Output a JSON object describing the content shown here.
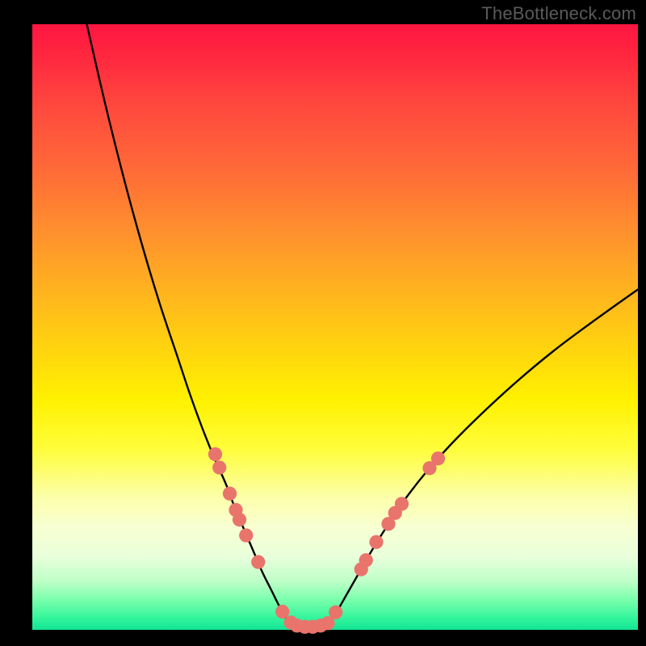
{
  "watermark": "TheBottleneck.com",
  "chart_data": {
    "type": "line",
    "title": "",
    "xlabel": "",
    "ylabel": "",
    "xlim": [
      0,
      100
    ],
    "ylim": [
      0,
      100
    ],
    "grid": false,
    "legend": false,
    "background_gradient": {
      "direction": "vertical",
      "stops": [
        {
          "pos": 0.0,
          "color": "#ff1540"
        },
        {
          "pos": 0.5,
          "color": "#ffd000"
        },
        {
          "pos": 0.8,
          "color": "#fbffb0"
        },
        {
          "pos": 1.0,
          "color": "#12e495"
        }
      ]
    },
    "series": [
      {
        "name": "left-curve",
        "stroke": "#000000",
        "x": [
          9,
          12,
          15,
          18,
          21,
          24,
          26,
          28,
          30,
          32,
          33.5,
          35,
          36.5,
          38,
          39.5,
          41,
          43
        ],
        "y": [
          100,
          87,
          75,
          64,
          54,
          45,
          39,
          33.5,
          28.5,
          24,
          20,
          16.5,
          13,
          9.5,
          6.5,
          3.5,
          0
        ]
      },
      {
        "name": "right-curve",
        "stroke": "#000000",
        "x": [
          48.5,
          50,
          52,
          54,
          56,
          58.5,
          61.5,
          65,
          69,
          74,
          80,
          86,
          92,
          98,
          100
        ],
        "y": [
          0,
          2.5,
          6,
          9.5,
          13,
          17,
          21.5,
          26,
          30.5,
          35.5,
          41,
          46,
          50.5,
          54.8,
          56.2
        ]
      },
      {
        "name": "valley-floor",
        "stroke": "#000000",
        "x": [
          43,
          44.5,
          46,
          47.5,
          48.5
        ],
        "y": [
          0,
          -0.1,
          -0.1,
          -0.1,
          0
        ]
      }
    ],
    "markers": {
      "name": "dots",
      "color": "#e9746c",
      "radius_pct": 1.15,
      "points": [
        {
          "x": 30.2,
          "y": 29.0
        },
        {
          "x": 30.9,
          "y": 26.8
        },
        {
          "x": 32.6,
          "y": 22.5
        },
        {
          "x": 33.6,
          "y": 19.8
        },
        {
          "x": 34.2,
          "y": 18.2
        },
        {
          "x": 35.3,
          "y": 15.6
        },
        {
          "x": 37.3,
          "y": 11.2
        },
        {
          "x": 41.3,
          "y": 3.0
        },
        {
          "x": 42.7,
          "y": 1.2
        },
        {
          "x": 43.7,
          "y": 0.7
        },
        {
          "x": 45.0,
          "y": 0.5
        },
        {
          "x": 46.3,
          "y": 0.5
        },
        {
          "x": 47.6,
          "y": 0.7
        },
        {
          "x": 48.8,
          "y": 1.1
        },
        {
          "x": 50.1,
          "y": 2.9
        },
        {
          "x": 54.3,
          "y": 10.0
        },
        {
          "x": 55.1,
          "y": 11.5
        },
        {
          "x": 56.8,
          "y": 14.5
        },
        {
          "x": 58.8,
          "y": 17.5
        },
        {
          "x": 59.9,
          "y": 19.3
        },
        {
          "x": 61.0,
          "y": 20.8
        },
        {
          "x": 65.6,
          "y": 26.7
        },
        {
          "x": 67.0,
          "y": 28.3
        }
      ]
    }
  }
}
